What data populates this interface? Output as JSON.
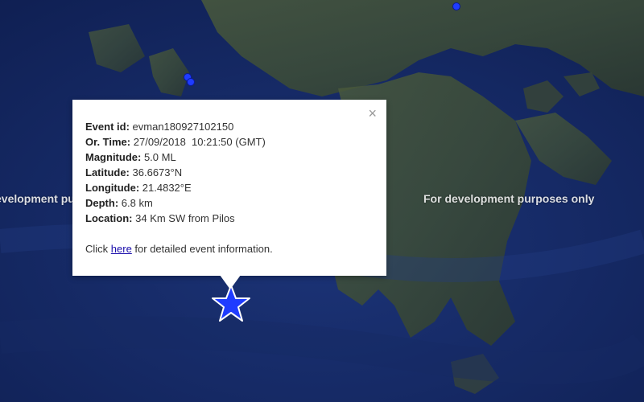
{
  "watermark": {
    "left_text": "evelopment pu",
    "right_text": "For development purposes only"
  },
  "popup": {
    "close_symbol": "×",
    "fields": [
      {
        "label": "Event id:",
        "value": "evman180927102150"
      },
      {
        "label": "Or. Time:",
        "value": "27/09/2018  10:21:50 (GMT)"
      },
      {
        "label": "Magnitude:",
        "value": "5.0 ML"
      },
      {
        "label": "Latitude:",
        "value": "36.6673°N"
      },
      {
        "label": "Longitude:",
        "value": "21.4832°E"
      },
      {
        "label": "Depth:",
        "value": "6.8 km"
      },
      {
        "label": "Location:",
        "value": "34 Km SW from Pilos"
      }
    ],
    "footer": {
      "prefix": "Click ",
      "link_text": "here",
      "suffix": " for detailed event information."
    }
  },
  "markers": {
    "event_color": "#1f3cff",
    "event_icon": "star-icon",
    "dot_icon": "circle-icon"
  }
}
